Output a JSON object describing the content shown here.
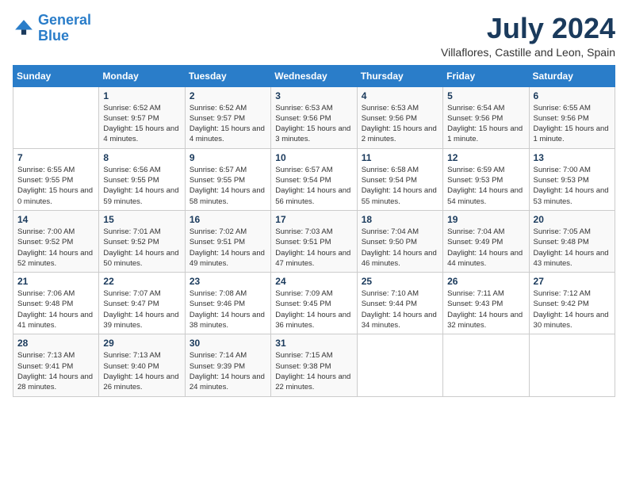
{
  "logo": {
    "line1": "General",
    "line2": "Blue"
  },
  "title": "July 2024",
  "location": "Villaflores, Castille and Leon, Spain",
  "header_days": [
    "Sunday",
    "Monday",
    "Tuesday",
    "Wednesday",
    "Thursday",
    "Friday",
    "Saturday"
  ],
  "weeks": [
    [
      {
        "day": "",
        "sunrise": "",
        "sunset": "",
        "daylight": ""
      },
      {
        "day": "1",
        "sunrise": "Sunrise: 6:52 AM",
        "sunset": "Sunset: 9:57 PM",
        "daylight": "Daylight: 15 hours and 4 minutes."
      },
      {
        "day": "2",
        "sunrise": "Sunrise: 6:52 AM",
        "sunset": "Sunset: 9:57 PM",
        "daylight": "Daylight: 15 hours and 4 minutes."
      },
      {
        "day": "3",
        "sunrise": "Sunrise: 6:53 AM",
        "sunset": "Sunset: 9:56 PM",
        "daylight": "Daylight: 15 hours and 3 minutes."
      },
      {
        "day": "4",
        "sunrise": "Sunrise: 6:53 AM",
        "sunset": "Sunset: 9:56 PM",
        "daylight": "Daylight: 15 hours and 2 minutes."
      },
      {
        "day": "5",
        "sunrise": "Sunrise: 6:54 AM",
        "sunset": "Sunset: 9:56 PM",
        "daylight": "Daylight: 15 hours and 1 minute."
      },
      {
        "day": "6",
        "sunrise": "Sunrise: 6:55 AM",
        "sunset": "Sunset: 9:56 PM",
        "daylight": "Daylight: 15 hours and 1 minute."
      }
    ],
    [
      {
        "day": "7",
        "sunrise": "Sunrise: 6:55 AM",
        "sunset": "Sunset: 9:55 PM",
        "daylight": "Daylight: 15 hours and 0 minutes."
      },
      {
        "day": "8",
        "sunrise": "Sunrise: 6:56 AM",
        "sunset": "Sunset: 9:55 PM",
        "daylight": "Daylight: 14 hours and 59 minutes."
      },
      {
        "day": "9",
        "sunrise": "Sunrise: 6:57 AM",
        "sunset": "Sunset: 9:55 PM",
        "daylight": "Daylight: 14 hours and 58 minutes."
      },
      {
        "day": "10",
        "sunrise": "Sunrise: 6:57 AM",
        "sunset": "Sunset: 9:54 PM",
        "daylight": "Daylight: 14 hours and 56 minutes."
      },
      {
        "day": "11",
        "sunrise": "Sunrise: 6:58 AM",
        "sunset": "Sunset: 9:54 PM",
        "daylight": "Daylight: 14 hours and 55 minutes."
      },
      {
        "day": "12",
        "sunrise": "Sunrise: 6:59 AM",
        "sunset": "Sunset: 9:53 PM",
        "daylight": "Daylight: 14 hours and 54 minutes."
      },
      {
        "day": "13",
        "sunrise": "Sunrise: 7:00 AM",
        "sunset": "Sunset: 9:53 PM",
        "daylight": "Daylight: 14 hours and 53 minutes."
      }
    ],
    [
      {
        "day": "14",
        "sunrise": "Sunrise: 7:00 AM",
        "sunset": "Sunset: 9:52 PM",
        "daylight": "Daylight: 14 hours and 52 minutes."
      },
      {
        "day": "15",
        "sunrise": "Sunrise: 7:01 AM",
        "sunset": "Sunset: 9:52 PM",
        "daylight": "Daylight: 14 hours and 50 minutes."
      },
      {
        "day": "16",
        "sunrise": "Sunrise: 7:02 AM",
        "sunset": "Sunset: 9:51 PM",
        "daylight": "Daylight: 14 hours and 49 minutes."
      },
      {
        "day": "17",
        "sunrise": "Sunrise: 7:03 AM",
        "sunset": "Sunset: 9:51 PM",
        "daylight": "Daylight: 14 hours and 47 minutes."
      },
      {
        "day": "18",
        "sunrise": "Sunrise: 7:04 AM",
        "sunset": "Sunset: 9:50 PM",
        "daylight": "Daylight: 14 hours and 46 minutes."
      },
      {
        "day": "19",
        "sunrise": "Sunrise: 7:04 AM",
        "sunset": "Sunset: 9:49 PM",
        "daylight": "Daylight: 14 hours and 44 minutes."
      },
      {
        "day": "20",
        "sunrise": "Sunrise: 7:05 AM",
        "sunset": "Sunset: 9:48 PM",
        "daylight": "Daylight: 14 hours and 43 minutes."
      }
    ],
    [
      {
        "day": "21",
        "sunrise": "Sunrise: 7:06 AM",
        "sunset": "Sunset: 9:48 PM",
        "daylight": "Daylight: 14 hours and 41 minutes."
      },
      {
        "day": "22",
        "sunrise": "Sunrise: 7:07 AM",
        "sunset": "Sunset: 9:47 PM",
        "daylight": "Daylight: 14 hours and 39 minutes."
      },
      {
        "day": "23",
        "sunrise": "Sunrise: 7:08 AM",
        "sunset": "Sunset: 9:46 PM",
        "daylight": "Daylight: 14 hours and 38 minutes."
      },
      {
        "day": "24",
        "sunrise": "Sunrise: 7:09 AM",
        "sunset": "Sunset: 9:45 PM",
        "daylight": "Daylight: 14 hours and 36 minutes."
      },
      {
        "day": "25",
        "sunrise": "Sunrise: 7:10 AM",
        "sunset": "Sunset: 9:44 PM",
        "daylight": "Daylight: 14 hours and 34 minutes."
      },
      {
        "day": "26",
        "sunrise": "Sunrise: 7:11 AM",
        "sunset": "Sunset: 9:43 PM",
        "daylight": "Daylight: 14 hours and 32 minutes."
      },
      {
        "day": "27",
        "sunrise": "Sunrise: 7:12 AM",
        "sunset": "Sunset: 9:42 PM",
        "daylight": "Daylight: 14 hours and 30 minutes."
      }
    ],
    [
      {
        "day": "28",
        "sunrise": "Sunrise: 7:13 AM",
        "sunset": "Sunset: 9:41 PM",
        "daylight": "Daylight: 14 hours and 28 minutes."
      },
      {
        "day": "29",
        "sunrise": "Sunrise: 7:13 AM",
        "sunset": "Sunset: 9:40 PM",
        "daylight": "Daylight: 14 hours and 26 minutes."
      },
      {
        "day": "30",
        "sunrise": "Sunrise: 7:14 AM",
        "sunset": "Sunset: 9:39 PM",
        "daylight": "Daylight: 14 hours and 24 minutes."
      },
      {
        "day": "31",
        "sunrise": "Sunrise: 7:15 AM",
        "sunset": "Sunset: 9:38 PM",
        "daylight": "Daylight: 14 hours and 22 minutes."
      },
      {
        "day": "",
        "sunrise": "",
        "sunset": "",
        "daylight": ""
      },
      {
        "day": "",
        "sunrise": "",
        "sunset": "",
        "daylight": ""
      },
      {
        "day": "",
        "sunrise": "",
        "sunset": "",
        "daylight": ""
      }
    ]
  ]
}
